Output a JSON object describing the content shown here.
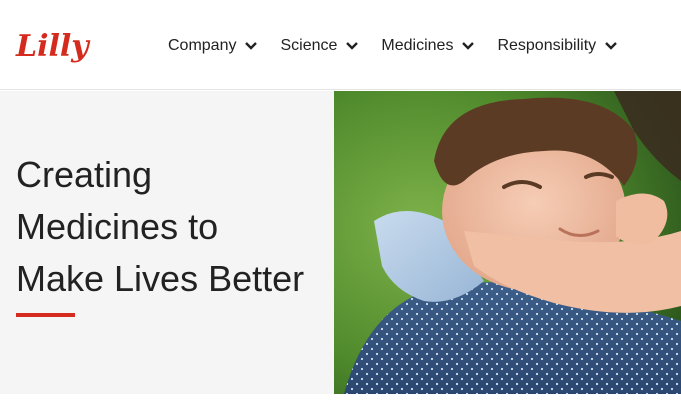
{
  "brand": {
    "logo_text": "Lilly",
    "color": "#d52b1e"
  },
  "nav": {
    "items": [
      {
        "label": "Company"
      },
      {
        "label": "Science"
      },
      {
        "label": "Medicines"
      },
      {
        "label": "Responsibility"
      }
    ],
    "chevron_icon": "chevron-down-icon"
  },
  "hero": {
    "title_lines": [
      "Creating",
      "Medicines to",
      "Make Lives Better"
    ],
    "accent_color": "#d52b1e",
    "image": "child-hugging-adult-photo"
  }
}
